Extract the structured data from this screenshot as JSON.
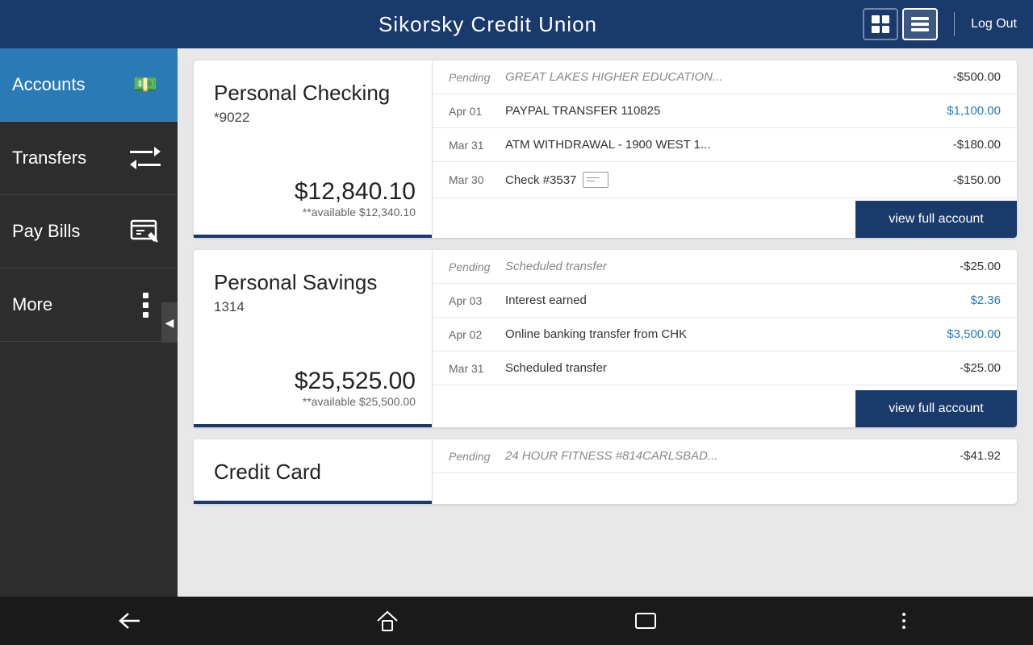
{
  "app": {
    "title": "Sikorsky Credit Union",
    "logout_label": "Log Out"
  },
  "sidebar": {
    "items": [
      {
        "id": "accounts",
        "label": "Accounts",
        "active": true
      },
      {
        "id": "transfers",
        "label": "Transfers",
        "active": false
      },
      {
        "id": "paybills",
        "label": "Pay Bills",
        "active": false
      },
      {
        "id": "more",
        "label": "More",
        "active": false
      }
    ]
  },
  "accounts": [
    {
      "id": "personal-checking",
      "name": "Personal Checking",
      "number": "*9022",
      "balance": "$12,840.10",
      "available": "**available $12,340.10",
      "view_full_label": "view full account",
      "transactions": [
        {
          "date": "Pending",
          "desc": "GREAT LAKES HIGHER EDUCATION...",
          "amount": "-$500.00",
          "positive": false,
          "pending": true,
          "has_check": false
        },
        {
          "date": "Apr 01",
          "desc": "PAYPAL TRANSFER 110825",
          "amount": "$1,100.00",
          "positive": true,
          "pending": false,
          "has_check": false
        },
        {
          "date": "Mar 31",
          "desc": "ATM WITHDRAWAL - 1900 WEST 1...",
          "amount": "-$180.00",
          "positive": false,
          "pending": false,
          "has_check": false
        },
        {
          "date": "Mar 30",
          "desc": "Check #3537",
          "amount": "-$150.00",
          "positive": false,
          "pending": false,
          "has_check": true
        }
      ]
    },
    {
      "id": "personal-savings",
      "name": "Personal Savings",
      "number": "1314",
      "balance": "$25,525.00",
      "available": "**available $25,500.00",
      "view_full_label": "view full account",
      "transactions": [
        {
          "date": "Pending",
          "desc": "Scheduled transfer",
          "amount": "-$25.00",
          "positive": false,
          "pending": true,
          "has_check": false
        },
        {
          "date": "Apr 03",
          "desc": "Interest earned",
          "amount": "$2.36",
          "positive": true,
          "pending": false,
          "has_check": false
        },
        {
          "date": "Apr 02",
          "desc": "Online banking transfer from CHK",
          "amount": "$3,500.00",
          "positive": true,
          "pending": false,
          "has_check": false
        },
        {
          "date": "Mar 31",
          "desc": "Scheduled transfer",
          "amount": "-$25.00",
          "positive": false,
          "pending": false,
          "has_check": false
        }
      ]
    },
    {
      "id": "credit-card",
      "name": "Credit Card",
      "number": "",
      "balance": "",
      "available": "",
      "view_full_label": "",
      "transactions": [
        {
          "date": "Pending",
          "desc": "24 HOUR FITNESS #814CARLSBAD...",
          "amount": "-$41.92",
          "positive": false,
          "pending": true,
          "has_check": false
        }
      ]
    }
  ],
  "bottom_nav": {
    "back_label": "←",
    "home_label": "⌂",
    "apps_label": "▭",
    "more_label": "⋮"
  }
}
